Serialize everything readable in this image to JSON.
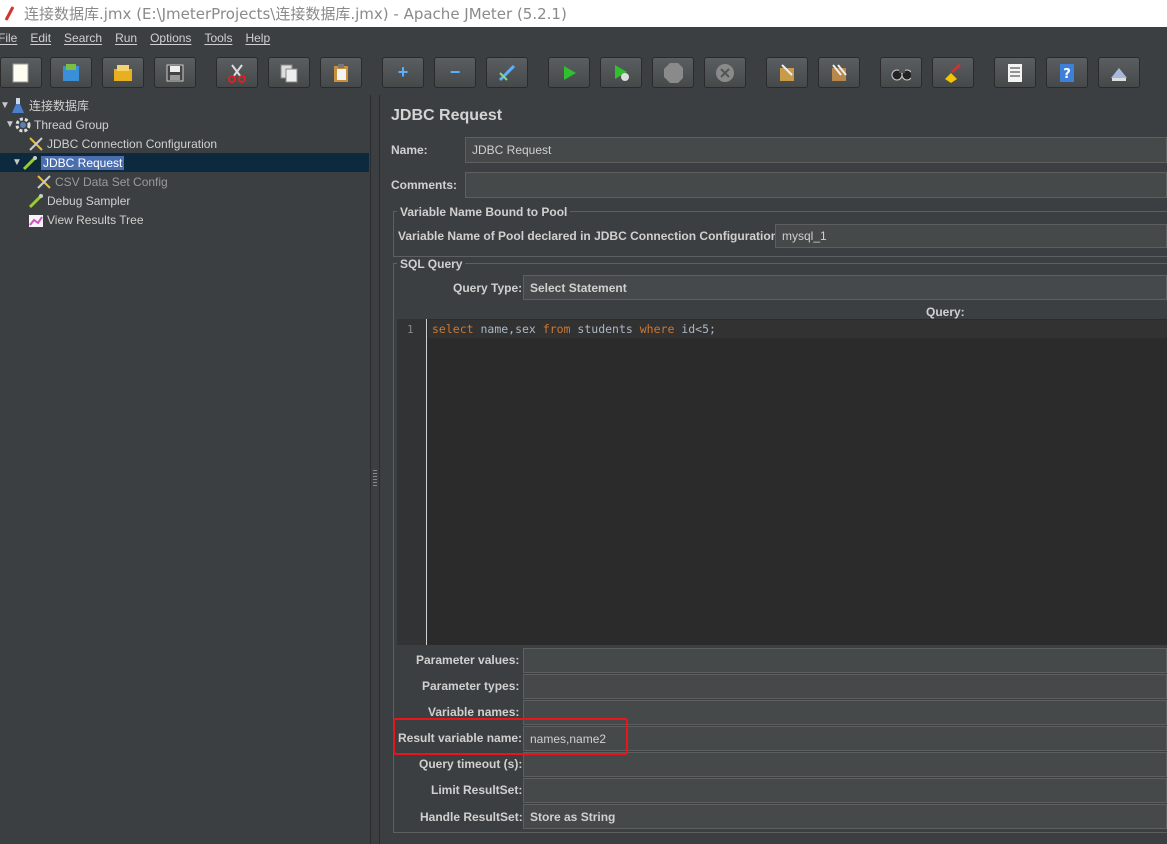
{
  "window": {
    "title": "连接数据库.jmx (E:\\JmeterProjects\\连接数据库.jmx) - Apache JMeter (5.2.1)"
  },
  "menu": [
    "File",
    "Edit",
    "Search",
    "Run",
    "Options",
    "Tools",
    "Help"
  ],
  "toolbar": [
    {
      "name": "new-icon"
    },
    {
      "name": "templates-icon"
    },
    {
      "name": "open-icon"
    },
    {
      "name": "save-icon"
    },
    {
      "name": "cut-icon"
    },
    {
      "name": "copy-icon"
    },
    {
      "name": "paste-icon"
    },
    {
      "name": "expand-icon"
    },
    {
      "name": "collapse-icon"
    },
    {
      "name": "toggle-icon"
    },
    {
      "name": "start-icon"
    },
    {
      "name": "start-no-pauses-icon"
    },
    {
      "name": "stop-icon"
    },
    {
      "name": "shutdown-icon"
    },
    {
      "name": "clear-icon"
    },
    {
      "name": "clear-all-icon"
    },
    {
      "name": "search-icon"
    },
    {
      "name": "reset-search-icon"
    },
    {
      "name": "function-helper-icon"
    },
    {
      "name": "help-icon"
    },
    {
      "name": "remote-icon"
    }
  ],
  "tree": {
    "items": [
      {
        "label": "连接数据库",
        "icon": "flask-icon"
      },
      {
        "label": "Thread Group",
        "icon": "gear-icon"
      },
      {
        "label": "JDBC Connection Configuration",
        "icon": "wrench-icon"
      },
      {
        "label": "JDBC Request",
        "icon": "pipette-icon"
      },
      {
        "label": "CSV Data Set Config",
        "icon": "wrench-icon"
      },
      {
        "label": "Debug Sampler",
        "icon": "pipette-icon"
      },
      {
        "label": "View Results Tree",
        "icon": "chart-icon"
      }
    ]
  },
  "panel": {
    "title": "JDBC Request",
    "name_label": "Name:",
    "name_value": "JDBC Request",
    "comments_label": "Comments:",
    "comments_value": "",
    "pool_group_title": "Variable Name Bound to Pool",
    "pool_label": "Variable Name of Pool declared in JDBC Connection Configuration:",
    "pool_value": "mysql_1",
    "sql_group_title": "SQL Query",
    "query_type_label": "Query Type:",
    "query_type_value": "Select Statement",
    "query_label": "Query:",
    "line_number": "1",
    "query_parts": {
      "kw1": "select",
      "t1": " name,sex ",
      "kw2": "from",
      "t2": " students ",
      "kw3": "where",
      "t3": " id<5;"
    },
    "param_values_label": "Parameter values:",
    "param_types_label": "Parameter types:",
    "variable_names_label": "Variable names:",
    "result_var_label": "Result variable name:",
    "result_var_value": "names,name2",
    "timeout_label": "Query timeout (s):",
    "limit_label": "Limit ResultSet:",
    "handle_label": "Handle ResultSet:",
    "handle_value": "Store as String"
  },
  "colors": {
    "background": "#3c3f41",
    "selection": "#4b6eaf",
    "highlight_box": "#e8161c",
    "sql_keyword": "#cc7832"
  }
}
